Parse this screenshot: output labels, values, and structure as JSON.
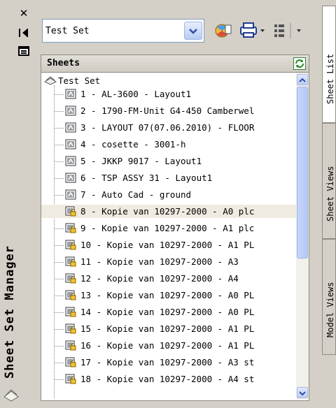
{
  "palette": {
    "title": "Sheet Set Manager",
    "buttons": [
      "close",
      "auto-hide",
      "properties"
    ]
  },
  "toolbar": {
    "selected_set": "Test Set",
    "buttons": [
      "publish-icon",
      "plot-icon",
      "view-options-icon"
    ]
  },
  "sheets": {
    "header": "Sheets",
    "root": "Test Set",
    "items": [
      {
        "label": "1 - AL-3600 - Layout1",
        "locked": false
      },
      {
        "label": "2 - 1790-FM-Unit G4-450 Camberwel",
        "locked": false
      },
      {
        "label": "3 - LAYOUT 07(07.06.2010) - FLOOR",
        "locked": false
      },
      {
        "label": "4 - cosette - 3001-h",
        "locked": false
      },
      {
        "label": "5 - JKKP 9017 - Layout1",
        "locked": false
      },
      {
        "label": "6 - TSP ASSY 31 - Layout1",
        "locked": false
      },
      {
        "label": "7 - Auto Cad - ground",
        "locked": false
      },
      {
        "label": "8 - Kopie van 10297-2000 - A0 plc",
        "locked": true,
        "selected": true
      },
      {
        "label": "9 - Kopie van 10297-2000 - A1 plc",
        "locked": true
      },
      {
        "label": "10 - Kopie van 10297-2000 - A1 PL",
        "locked": true
      },
      {
        "label": "11 - Kopie van 10297-2000 - A3",
        "locked": true
      },
      {
        "label": "12 - Kopie van 10297-2000 - A4",
        "locked": true
      },
      {
        "label": "13 - Kopie van 10297-2000 - A0 PL",
        "locked": true
      },
      {
        "label": "14 - Kopie van 10297-2000 - A0 PL",
        "locked": true
      },
      {
        "label": "15 - Kopie van 10297-2000 - A1 PL",
        "locked": true
      },
      {
        "label": "16 - Kopie van 10297-2000 - A1 PL",
        "locked": true
      },
      {
        "label": "17 - Kopie van 10297-2000 - A3 st",
        "locked": true
      },
      {
        "label": "18 - Kopie van 10297-2000 - A4 st",
        "locked": true
      }
    ]
  },
  "tabs": [
    {
      "label": "Sheet List",
      "active": true
    },
    {
      "label": "Sheet Views",
      "active": false
    },
    {
      "label": "Model Views",
      "active": false
    }
  ]
}
